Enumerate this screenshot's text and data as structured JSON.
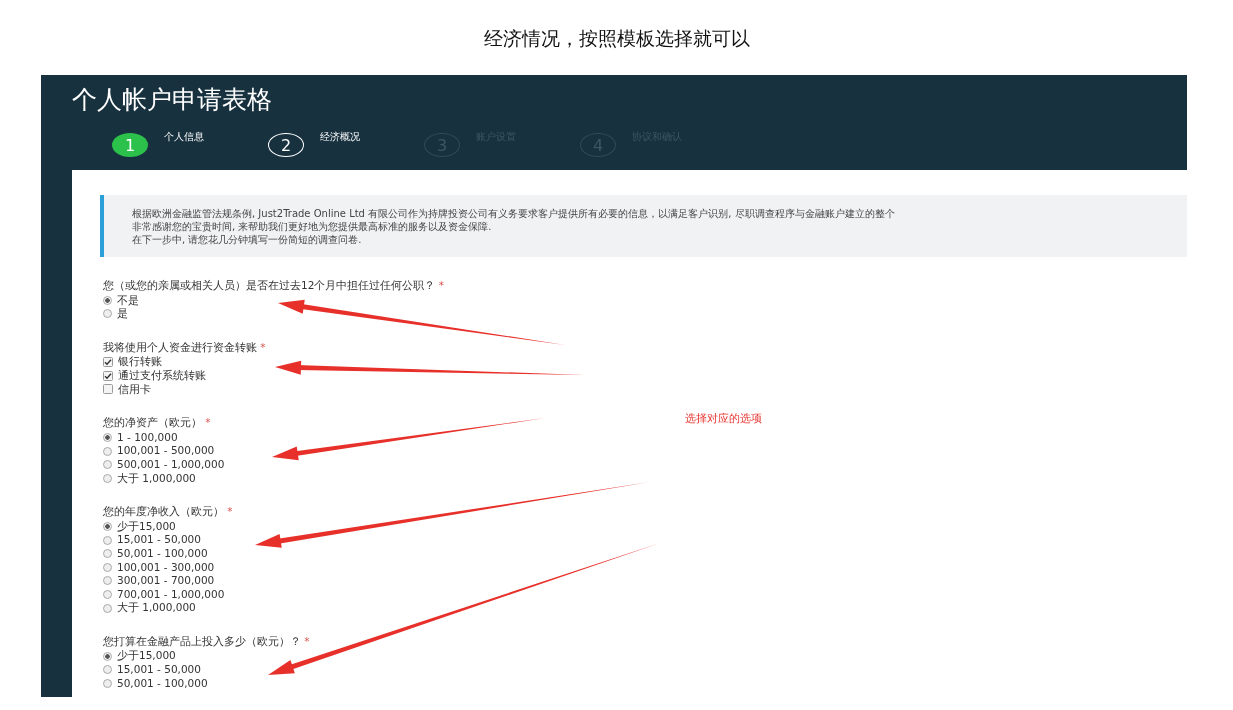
{
  "caption": "经济情况，按照模板选择就可以",
  "form": {
    "title": "个人帐户申请表格",
    "steps": [
      {
        "number": "1",
        "label": "个人信息",
        "completed": true,
        "disabled": false
      },
      {
        "number": "2",
        "label": "经济概况",
        "completed": false,
        "disabled": false
      },
      {
        "number": "3",
        "label": "账户设置",
        "completed": false,
        "disabled": true
      },
      {
        "number": "4",
        "label": "协议和确认",
        "completed": false,
        "disabled": true
      }
    ],
    "notice": [
      "根据欧洲金融监管法规条例, Just2Trade Online Ltd 有限公司作为持牌投资公司有义务要求客户提供所有必要的信息，以满足客户识别, 尽职调查程序与金融账户建立的整个",
      "非常感谢您的宝贵时间, 来帮助我们更好地为您提供最高标准的服务以及资金保障.",
      "在下一步中, 请您花几分钟填写一份简短的调查问卷."
    ],
    "questions": [
      {
        "kind": "radio",
        "label": "您（或您的亲属或相关人员）是否在过去12个月中担任过任何公职？",
        "asterisk": "*",
        "options": [
          {
            "label": "不是",
            "selected": true
          },
          {
            "label": "是",
            "selected": false
          }
        ]
      },
      {
        "kind": "checkbox",
        "label": "我将使用个人资金进行资金转账",
        "asterisk": "*",
        "options": [
          {
            "label": "银行转账",
            "checked": true
          },
          {
            "label": "通过支付系统转账",
            "checked": true
          },
          {
            "label": "信用卡",
            "checked": false
          }
        ]
      },
      {
        "kind": "radio",
        "label": "您的净资产（欧元）",
        "asterisk": "*",
        "options": [
          {
            "label": "1 - 100,000",
            "selected": true
          },
          {
            "label": "100,001 - 500,000",
            "selected": false
          },
          {
            "label": "500,001 - 1,000,000",
            "selected": false
          },
          {
            "label": "大于 1,000,000",
            "selected": false
          }
        ]
      },
      {
        "kind": "radio",
        "label": "您的年度净收入（欧元）",
        "asterisk": "*",
        "options": [
          {
            "label": "少于15,000",
            "selected": true
          },
          {
            "label": "15,001 - 50,000",
            "selected": false
          },
          {
            "label": "50,001 - 100,000",
            "selected": false
          },
          {
            "label": "100,001 - 300,000",
            "selected": false
          },
          {
            "label": "300,001 - 700,000",
            "selected": false
          },
          {
            "label": "700,001 - 1,000,000",
            "selected": false
          },
          {
            "label": "大于 1,000,000",
            "selected": false
          }
        ]
      },
      {
        "kind": "radio",
        "label": "您打算在金融产品上投入多少（欧元）？",
        "asterisk": "*",
        "options": [
          {
            "label": "少于15,000",
            "selected": true
          },
          {
            "label": "15,001 - 50,000",
            "selected": false
          },
          {
            "label": "50,001 - 100,000",
            "selected": false
          }
        ]
      }
    ]
  },
  "annotation": "选择对应的选项"
}
